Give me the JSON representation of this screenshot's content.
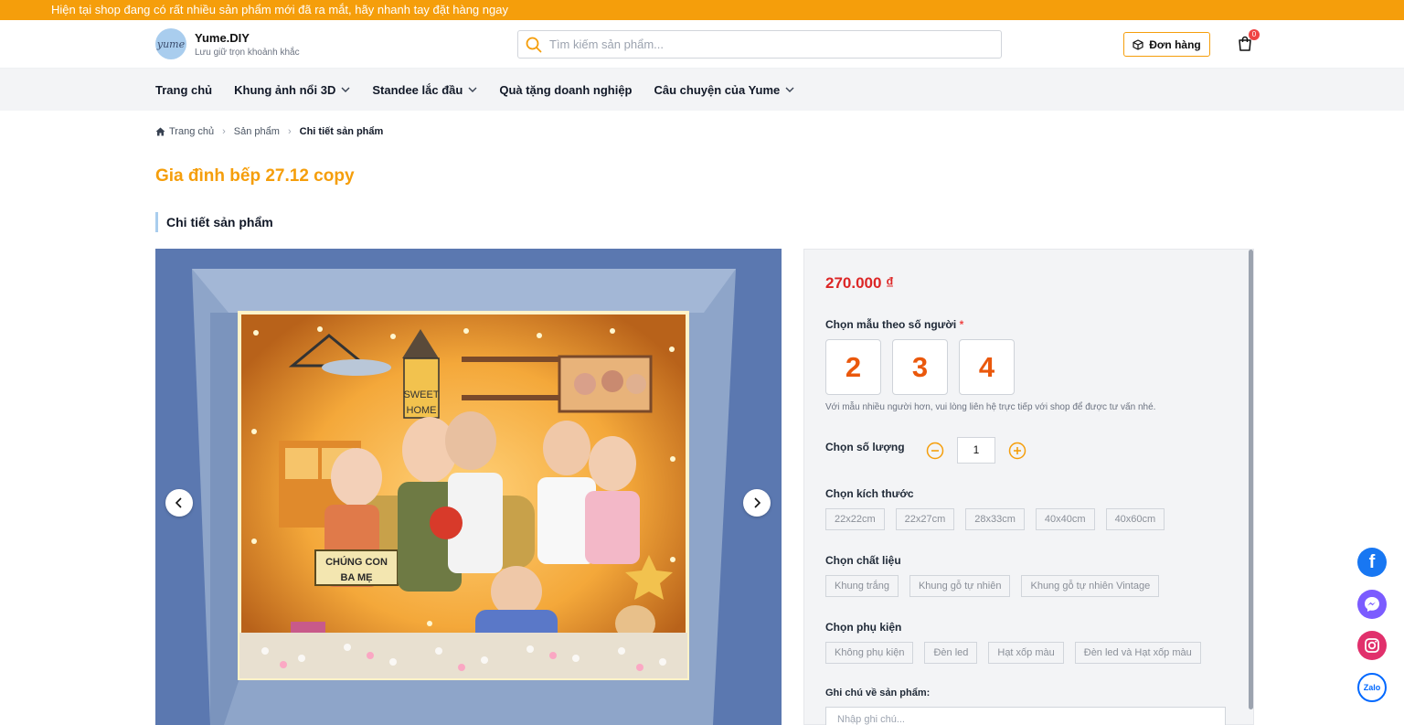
{
  "promo": {
    "text": "Hiện tại shop đang có rất nhiều sản phẩm mới đã ra mắt, hãy nhanh tay đặt hàng ngay"
  },
  "header": {
    "logo_text": "yume",
    "brand_name": "Yume.DIY",
    "tagline": "Lưu giữ trọn khoảnh khắc",
    "search_placeholder": "Tìm kiếm sản phẩm...",
    "order_label": "Đơn hàng",
    "cart_count": "0"
  },
  "nav": {
    "items": [
      {
        "label": "Trang chủ",
        "has_dropdown": false
      },
      {
        "label": "Khung ảnh nổi 3D",
        "has_dropdown": true
      },
      {
        "label": "Standee lắc đầu",
        "has_dropdown": true
      },
      {
        "label": "Quà tặng doanh nghiệp",
        "has_dropdown": false
      },
      {
        "label": "Câu chuyện của Yume",
        "has_dropdown": true
      }
    ]
  },
  "breadcrumb": {
    "home": "Trang chủ",
    "products": "Sản phẩm",
    "current": "Chi tiết sản phẩm"
  },
  "product": {
    "title": "Gia đình bếp 27.12 copy",
    "section_heading": "Chi tiết sản phẩm",
    "image_texts": {
      "sign_top": "SWEET",
      "sign_bottom": "HOME",
      "board_top": "CHÚNG CON",
      "board_bottom": "BA MẸ"
    },
    "price": "270.000 ₫",
    "people": {
      "label": "Chọn mẫu theo số người",
      "required_mark": "*",
      "options": [
        "2",
        "3",
        "4"
      ],
      "hint": "Với mẫu nhiều người hơn, vui lòng liên hệ trực tiếp với shop để được tư vấn nhé."
    },
    "quantity": {
      "label": "Chọn số lượng",
      "value": "1"
    },
    "size": {
      "label": "Chọn kích thước",
      "options": [
        "22x22cm",
        "22x27cm",
        "28x33cm",
        "40x40cm",
        "40x60cm"
      ]
    },
    "material": {
      "label": "Chọn chất liệu",
      "options": [
        "Khung trắng",
        "Khung gỗ tự nhiên",
        "Khung gỗ tự nhiên Vintage"
      ]
    },
    "accessory": {
      "label": "Chọn phụ kiện",
      "options": [
        "Không phụ kiện",
        "Đèn led",
        "Hạt xốp màu",
        "Đèn led và Hạt xốp màu"
      ]
    },
    "note": {
      "label": "Ghi chú về sản phẩm:",
      "placeholder": "Nhập ghi chú..."
    }
  },
  "social": [
    {
      "name": "facebook-icon",
      "label": "f",
      "color": "#1877f2"
    },
    {
      "name": "messenger-icon",
      "label": "",
      "color": "#7b5cff"
    },
    {
      "name": "instagram-icon",
      "label": "",
      "color": "#e1306c"
    },
    {
      "name": "zalo-icon",
      "label": "Zalo",
      "color": "#0068ff"
    }
  ],
  "colors": {
    "accent": "#f59e0b",
    "price": "#dc2626",
    "number": "#ea580c"
  }
}
